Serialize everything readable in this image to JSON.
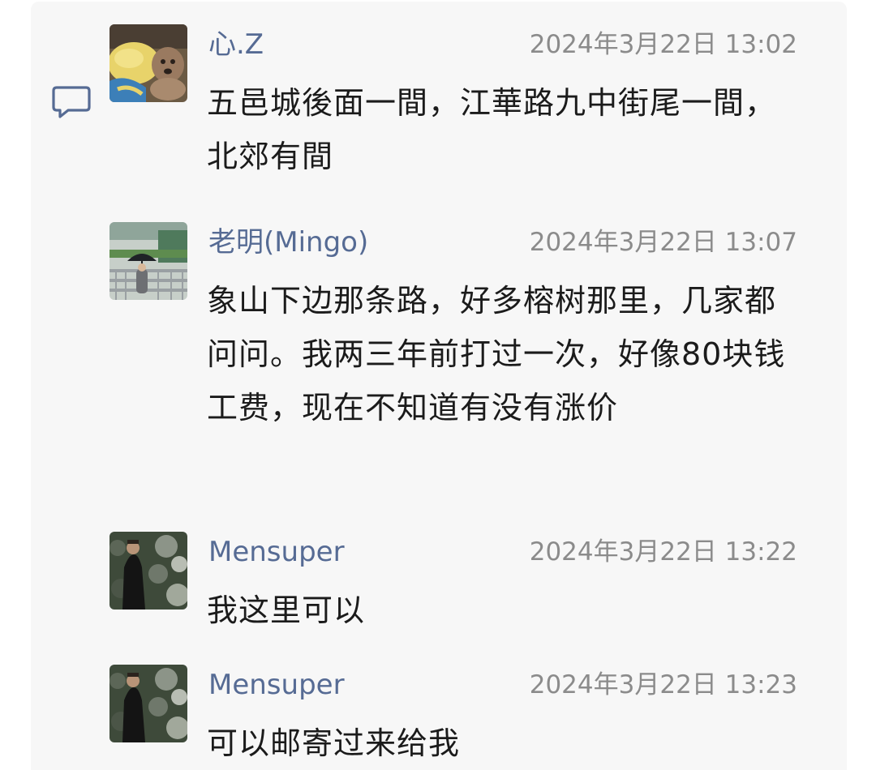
{
  "comments": [
    {
      "name": "心.Z",
      "time": "2024年3月22日 13:02",
      "text": "五邑城後面一間，江華路九中街尾一間，北郊有間",
      "avatar": "avatar-dog-photo"
    },
    {
      "name": "老明(Mingo)",
      "time": "2024年3月22日 13:07",
      "text": "象山下边那条路，好多榕树那里，几家都问问。我两三年前打过一次，好像80块钱工费，现在不知道有没有涨价",
      "avatar": "avatar-umbrella-photo"
    },
    {
      "name": "Mensuper",
      "time": "2024年3月22日 13:22",
      "text": "我这里可以",
      "avatar": "avatar-man-coat-photo"
    },
    {
      "name": "Mensuper",
      "time": "2024年3月22日 13:23",
      "text": "可以邮寄过来给我",
      "avatar": "avatar-man-coat-photo"
    }
  ],
  "icons": {
    "comment_icon": "comment-bubble-icon"
  },
  "colors": {
    "panel_background": "#f7f7f7",
    "name_color": "#566b94",
    "time_color": "#8b8b8b",
    "text_color": "#1b1b1b",
    "icon_color": "#566b94"
  }
}
